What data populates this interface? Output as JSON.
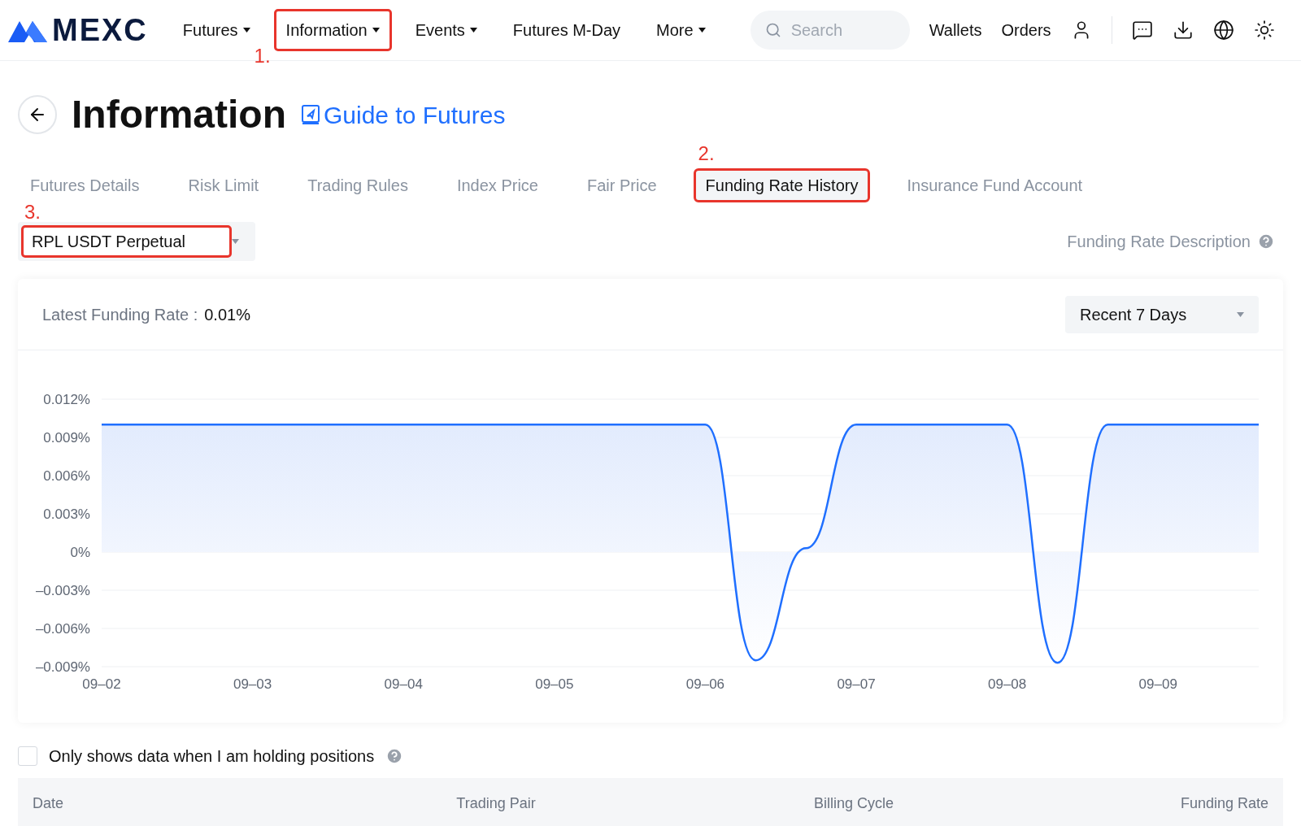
{
  "header": {
    "logo_text": "MEXC",
    "nav": [
      {
        "label": "Futures",
        "dropdown": true,
        "highlighted": false
      },
      {
        "label": "Information",
        "dropdown": true,
        "highlighted": true,
        "step": "1."
      },
      {
        "label": "Events",
        "dropdown": true,
        "highlighted": false
      },
      {
        "label": "Futures M-Day",
        "dropdown": false,
        "highlighted": false
      },
      {
        "label": "More",
        "dropdown": true,
        "highlighted": false
      }
    ],
    "search": {
      "placeholder": "Search"
    },
    "links": [
      "Wallets",
      "Orders"
    ]
  },
  "page": {
    "title": "Information",
    "guide_link": "Guide to Futures"
  },
  "tabs": [
    {
      "label": "Futures Details",
      "selected": false,
      "highlighted": false
    },
    {
      "label": "Risk Limit",
      "selected": false,
      "highlighted": false
    },
    {
      "label": "Trading Rules",
      "selected": false,
      "highlighted": false
    },
    {
      "label": "Index Price",
      "selected": false,
      "highlighted": false
    },
    {
      "label": "Fair Price",
      "selected": false,
      "highlighted": false
    },
    {
      "label": "Funding Rate History",
      "selected": true,
      "highlighted": true,
      "step": "2."
    },
    {
      "label": "Insurance Fund Account",
      "selected": false,
      "highlighted": false
    }
  ],
  "contract_select": {
    "value": "RPL USDT Perpetual",
    "highlighted": true,
    "step": "3."
  },
  "description_link": "Funding Rate Description",
  "card": {
    "latest_label": "Latest Funding Rate :",
    "latest_value": "0.01%",
    "range_select": "Recent 7 Days",
    "chart_data": {
      "type": "area",
      "categories": [
        "09–02",
        null,
        null,
        "09–03",
        null,
        null,
        "09–04",
        null,
        null,
        "09–05",
        null,
        null,
        "09–06",
        null,
        null,
        "09–07",
        null,
        null,
        "09–08",
        null,
        null,
        "09–09",
        null,
        null
      ],
      "series": [
        {
          "color": "#1f6fff",
          "values": [
            0.01,
            0.01,
            0.01,
            0.01,
            0.01,
            0.01,
            0.01,
            0.01,
            0.01,
            0.01,
            0.01,
            0.01,
            0.01,
            -0.0085,
            0.0003,
            0.01,
            0.01,
            0.01,
            0.01,
            -0.0087,
            0.01,
            0.01,
            0.01,
            0.01
          ]
        }
      ],
      "ylim": [
        -0.009,
        0.012
      ],
      "grid": true,
      "yticks": [
        {
          "value": 0.012,
          "label": "0.012%"
        },
        {
          "value": 0.009,
          "label": "0.009%"
        },
        {
          "value": 0.006,
          "label": "0.006%"
        },
        {
          "value": 0.003,
          "label": "0.003%"
        },
        {
          "value": 0,
          "label": "0%"
        },
        {
          "value": -0.003,
          "label": "–0.003%"
        },
        {
          "value": -0.006,
          "label": "–0.006%"
        },
        {
          "value": -0.009,
          "label": "–0.009%"
        }
      ]
    }
  },
  "holding_filter": {
    "label": "Only shows data when I am holding positions",
    "checked": false
  },
  "table": {
    "columns": [
      "Date",
      "Trading Pair",
      "Billing Cycle",
      "Funding Rate"
    ]
  }
}
